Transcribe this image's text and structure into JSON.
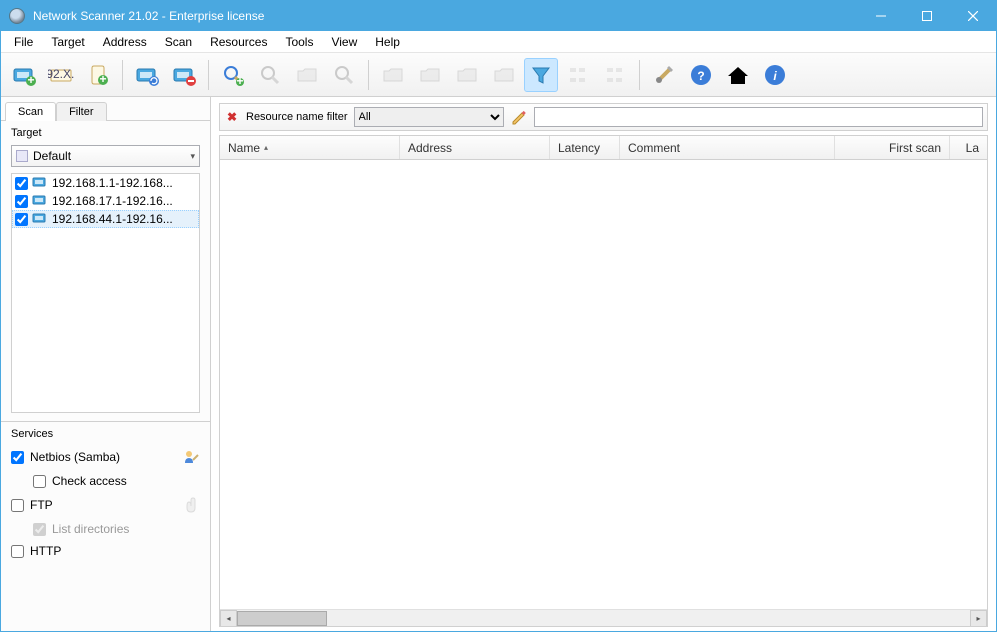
{
  "window": {
    "title": "Network Scanner 21.02 - Enterprise license"
  },
  "menu": [
    "File",
    "Target",
    "Address",
    "Scan",
    "Resources",
    "Tools",
    "View",
    "Help"
  ],
  "tabs": {
    "scan": "Scan",
    "filter": "Filter"
  },
  "target": {
    "label": "Target",
    "preset": "Default",
    "items": [
      {
        "checked": true,
        "range": "192.168.1.1-192.168..."
      },
      {
        "checked": true,
        "range": "192.168.17.1-192.16..."
      },
      {
        "checked": true,
        "range": "192.168.44.1-192.16...",
        "selected": true
      }
    ]
  },
  "services": {
    "label": "Services",
    "netbios": {
      "checked": true,
      "label": "Netbios (Samba)"
    },
    "check_access": {
      "checked": false,
      "label": "Check access"
    },
    "ftp": {
      "checked": false,
      "label": "FTP"
    },
    "list_dirs": {
      "checked": true,
      "label": "List directories"
    },
    "http": {
      "checked": false,
      "label": "HTTP"
    }
  },
  "filterbar": {
    "label": "Resource name filter",
    "value": "All",
    "search_placeholder": ""
  },
  "columns": {
    "name": "Name",
    "address": "Address",
    "latency": "Latency",
    "comment": "Comment",
    "first_scan": "First scan",
    "last": "La"
  }
}
